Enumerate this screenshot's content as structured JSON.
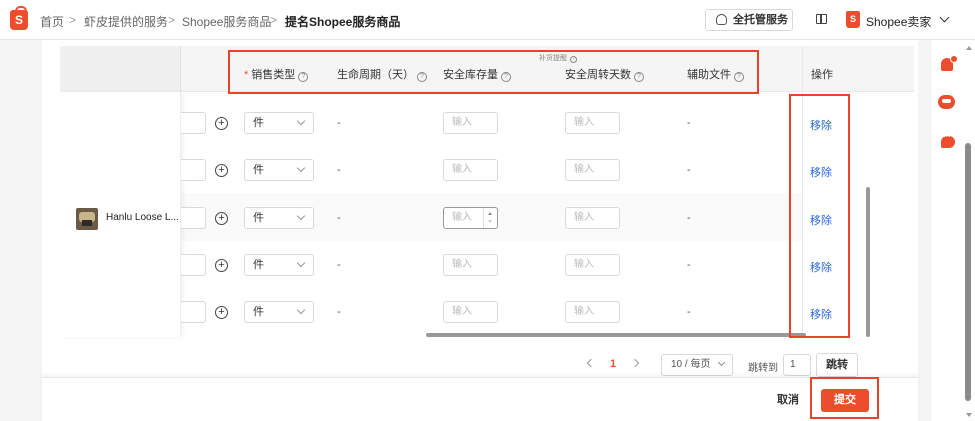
{
  "breadcrumb": {
    "items": [
      "首页",
      "虾皮提供的服务",
      "Shopee服务商品"
    ],
    "separator": ">",
    "current": "提名Shopee服务商品"
  },
  "header": {
    "logo_letter": "S",
    "managed_service_label": "全托管服务",
    "seller_logo_letter": "S",
    "seller_name": "Shopee卖家"
  },
  "table": {
    "group_label": "补货提醒",
    "columns": {
      "sales_type": "销售类型",
      "lifecycle": "生命周期（天）",
      "safety_stock": "安全库存量",
      "safety_turnover_days": "安全周转天数",
      "aux_file": "辅助文件",
      "actions": "操作"
    },
    "required_mark": "*",
    "help_glyph": "?",
    "product_name": "Hanlu Loose L...",
    "rows": [
      {
        "unit": "件",
        "lifecycle": "-",
        "safety_stock_placeholder": "输入",
        "turnover_placeholder": "输入",
        "aux_file": "-",
        "action": "移除"
      },
      {
        "unit": "件",
        "lifecycle": "-",
        "safety_stock_placeholder": "输入",
        "turnover_placeholder": "输入",
        "aux_file": "-",
        "action": "移除"
      },
      {
        "unit": "件",
        "lifecycle": "-",
        "safety_stock_placeholder": "输入",
        "turnover_placeholder": "输入",
        "aux_file": "-",
        "action": "移除"
      },
      {
        "unit": "件",
        "lifecycle": "-",
        "safety_stock_placeholder": "输入",
        "turnover_placeholder": "输入",
        "aux_file": "-",
        "action": "移除"
      },
      {
        "unit": "件",
        "lifecycle": "-",
        "safety_stock_placeholder": "输入",
        "turnover_placeholder": "输入",
        "aux_file": "-",
        "action": "移除"
      }
    ]
  },
  "pagination": {
    "current_page": "1",
    "page_size": "10 / 每页",
    "jump_label": "跳转到",
    "jump_value": "1",
    "jump_button": "跳转"
  },
  "footer": {
    "cancel_label": "取消",
    "submit_label": "提交"
  },
  "colors": {
    "brand": "#ee4d2d",
    "link": "#2a6ad6",
    "annotation": "#e8432c"
  }
}
